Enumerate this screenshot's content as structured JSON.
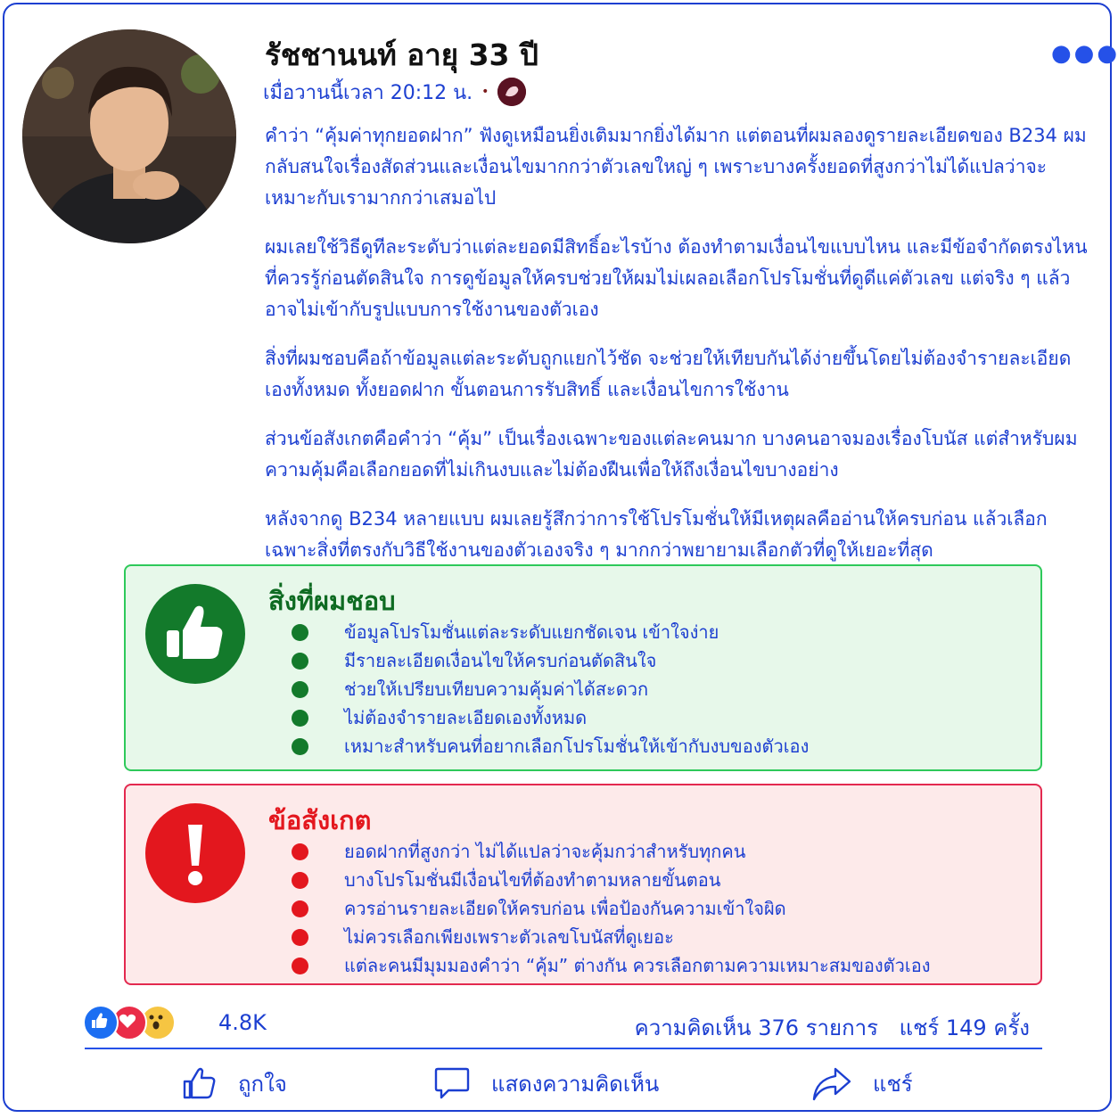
{
  "post": {
    "author": "รัชชานนท์ อายุ 33 ปี",
    "timestamp": "เมื่อวานนี้เวลา 20:12 น.",
    "separator": "•",
    "paragraphs": [
      "คำว่า “คุ้มค่าทุกยอดฝาก” ฟังดูเหมือนยิ่งเติมมากยิ่งได้มาก แต่ตอนที่ผมลองดูรายละเอียดของ B234 ผมกลับสนใจเรื่องสัดส่วนและเงื่อนไขมากกว่าตัวเลขใหญ่ ๆ เพราะบางครั้งยอดที่สูงกว่าไม่ได้แปลว่าจะเหมาะกับเรามากกว่าเสมอไป",
      "ผมเลยใช้วิธีดูทีละระดับว่าแต่ละยอดมีสิทธิ์อะไรบ้าง ต้องทำตามเงื่อนไขแบบไหน และมีข้อจำกัดตรงไหนที่ควรรู้ก่อนตัดสินใจ การดูข้อมูลให้ครบช่วยให้ผมไม่เผลอเลือกโปรโมชั่นที่ดูดีแค่ตัวเลข แต่จริง ๆ แล้วอาจไม่เข้ากับรูปแบบการใช้งานของตัวเอง",
      "สิ่งที่ผมชอบคือถ้าข้อมูลแต่ละระดับถูกแยกไว้ชัด จะช่วยให้เทียบกันได้ง่ายขึ้นโดยไม่ต้องจำรายละเอียดเองทั้งหมด ทั้งยอดฝาก ขั้นตอนการรับสิทธิ์ และเงื่อนไขการใช้งาน",
      "ส่วนข้อสังเกตคือคำว่า “คุ้ม” เป็นเรื่องเฉพาะของแต่ละคนมาก บางคนอาจมองเรื่องโบนัส แต่สำหรับผมความคุ้มคือเลือกยอดที่ไม่เกินงบและไม่ต้องฝืนเพื่อให้ถึงเงื่อนไขบางอย่าง",
      "หลังจากดู B234 หลายแบบ ผมเลยรู้สึกว่าการใช้โปรโมชั่นให้มีเหตุผลคืออ่านให้ครบก่อน แล้วเลือกเฉพาะสิ่งที่ตรงกับวิธีใช้งานของตัวเองจริง ๆ มากกว่าพยายามเลือกตัวที่ดูให้เยอะที่สุด"
    ]
  },
  "likes_box": {
    "title": "สิ่งที่ผมชอบ",
    "items": [
      "ข้อมูลโปรโมชั่นแต่ละระดับแยกชัดเจน เข้าใจง่าย",
      "มีรายละเอียดเงื่อนไขให้ครบก่อนตัดสินใจ",
      "ช่วยให้เปรียบเทียบความคุ้มค่าได้สะดวก",
      "ไม่ต้องจำรายละเอียดเองทั้งหมด",
      "เหมาะสำหรับคนที่อยากเลือกโปรโมชั่นให้เข้ากับงบของตัวเอง"
    ]
  },
  "notes_box": {
    "title": "ข้อสังเกต",
    "items": [
      "ยอดฝากที่สูงกว่า ไม่ได้แปลว่าจะคุ้มกว่าสำหรับทุกคน",
      "บางโปรโมชั่นมีเงื่อนไขที่ต้องทำตามหลายขั้นตอน",
      "ควรอ่านรายละเอียดให้ครบก่อน เพื่อป้องกันความเข้าใจผิด",
      "ไม่ควรเลือกเพียงเพราะตัวเลขโบนัสที่ดูเยอะ",
      "แต่ละคนมีมุมมองคำว่า “คุ้ม” ต่างกัน ควรเลือกตามความเหมาะสมของตัวเอง"
    ]
  },
  "engagement": {
    "reaction_count": "4.8K",
    "comments": "ความคิดเห็น 376 รายการ",
    "shares": "แชร์ 149 ครั้ง"
  },
  "actions": {
    "like": "ถูกใจ",
    "comment": "แสดงความคิดเห็น",
    "share": "แชร์"
  },
  "icons": {
    "more": "more-dots-icon",
    "privacy": "privacy-icon",
    "thumbs_up": "thumbs-up-icon",
    "exclamation": "exclamation-icon",
    "check_bullet": "check-bullet-icon",
    "red_bullet": "red-bullet-icon",
    "reaction_like": "like-reaction-icon",
    "reaction_love": "love-reaction-icon",
    "reaction_wow": "wow-reaction-icon",
    "comment": "comment-icon",
    "share": "share-icon"
  },
  "colors": {
    "accent_blue": "#1c3fd1",
    "good_green": "#137a2b",
    "warn_red": "#e3171e",
    "good_bg": "#e7f8ea",
    "warn_bg": "#fdeaea"
  }
}
